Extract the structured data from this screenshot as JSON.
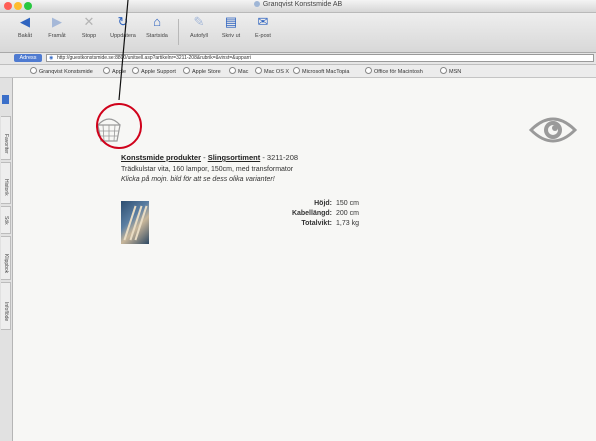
{
  "window": {
    "title": "Granqvist Konstsmide AB",
    "traffic_lights": [
      "#ff5f57",
      "#febc2e",
      "#28c840"
    ]
  },
  "toolbar": {
    "buttons": [
      {
        "label": "Bakåt",
        "icon": "back-arrow-icon"
      },
      {
        "label": "Framåt",
        "icon": "forward-arrow-icon"
      },
      {
        "label": "Stopp",
        "icon": "stop-icon"
      },
      {
        "label": "Uppdatera",
        "icon": "refresh-icon"
      },
      {
        "label": "Startsida",
        "icon": "home-icon"
      },
      {
        "label": "Autofyll",
        "icon": "autofill-icon"
      },
      {
        "label": "Skriv ut",
        "icon": "print-icon"
      },
      {
        "label": "E-post",
        "icon": "mail-icon"
      }
    ]
  },
  "address": {
    "label": "Adress",
    "url": "http://guestkonstsmide.se:8800/unitsell.asp?artikelnr=3211-208&rubrik=&vinst=&upparri"
  },
  "favorites": [
    "Granqvist Konstsmide",
    "Apple",
    "Apple Support",
    "Apple Store",
    "Mac",
    "Mac OS X",
    "Microsoft MacTopia",
    "Office för Macintosh",
    "MSN"
  ],
  "side_tabs": [
    "Favoriter",
    "Historik",
    "Sök",
    "Klippbok",
    "Infoflöde"
  ],
  "product": {
    "heading_link1": "Konstsmide produkter",
    "heading_sep": "-",
    "heading_link2": "Slingsortiment",
    "heading_code": "- 3211-208",
    "desc_line1": "Trädkulstar vita, 160 lampor, 150cm, med transformator",
    "desc_line2": "Klicka på mojn. bild för att se dess olika varianter!",
    "specs": [
      {
        "label": "Höjd:",
        "value": "150 cm"
      },
      {
        "label": "Kabellängd:",
        "value": "200 cm"
      },
      {
        "label": "Totalvikt:",
        "value": "1,73 kg"
      }
    ]
  },
  "colors": {
    "callout": "#d0021b",
    "accent": "#3b6fc9"
  }
}
